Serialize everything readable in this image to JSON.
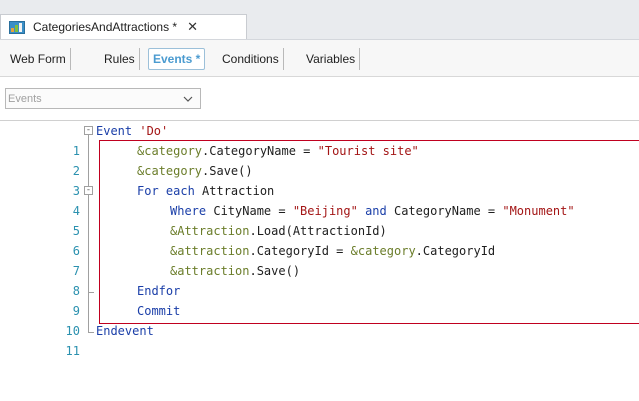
{
  "tab": {
    "title": "CategoriesAndAttractions *",
    "close": "✕",
    "icon": "folder-bars-icon"
  },
  "subtabs": [
    {
      "label": "Web Form",
      "active": false
    },
    {
      "label": "Rules",
      "active": false
    },
    {
      "label": "Events *",
      "active": true
    },
    {
      "label": "Conditions",
      "active": false
    },
    {
      "label": "Variables",
      "active": false
    }
  ],
  "events_select": {
    "value": "Events"
  },
  "code": {
    "line_numbers": [
      "1",
      "2",
      "3",
      "4",
      "5",
      "6",
      "7",
      "8",
      "9",
      "10",
      "11"
    ],
    "fold_markers": [
      "-",
      "-"
    ],
    "l1_kw": "Event",
    "l1_str": "'Do'",
    "l2_var": "&category",
    "l2_attr": ".CategoryName = ",
    "l2_str": "\"Tourist site\"",
    "l3_var": "&category",
    "l3_fn": ".Save()",
    "l4_kw": "For each",
    "l4_fn": " Attraction",
    "l5_kw": "Where",
    "l5_a": " CityName = ",
    "l5_s1": "\"Beijing\"",
    "l5_kw2": " and ",
    "l5_b": "CategoryName = ",
    "l5_s2": "\"Monument\"",
    "l6_var": "&Attraction",
    "l6_fn": ".Load(AttractionId)",
    "l7_var": "&attraction",
    "l7_fn": ".CategoryId = ",
    "l7_var2": "&category",
    "l7_fn2": ".CategoryId",
    "l8_var": "&attraction",
    "l8_fn": ".Save()",
    "l9_kw": "Endfor",
    "l10_kw": "Commit",
    "l11_kw": "Endevent"
  },
  "colors": {
    "keyword": "#1a3ea8",
    "variable": "#6b7d2a",
    "string": "#a31515",
    "highlight": "#c0001f"
  }
}
